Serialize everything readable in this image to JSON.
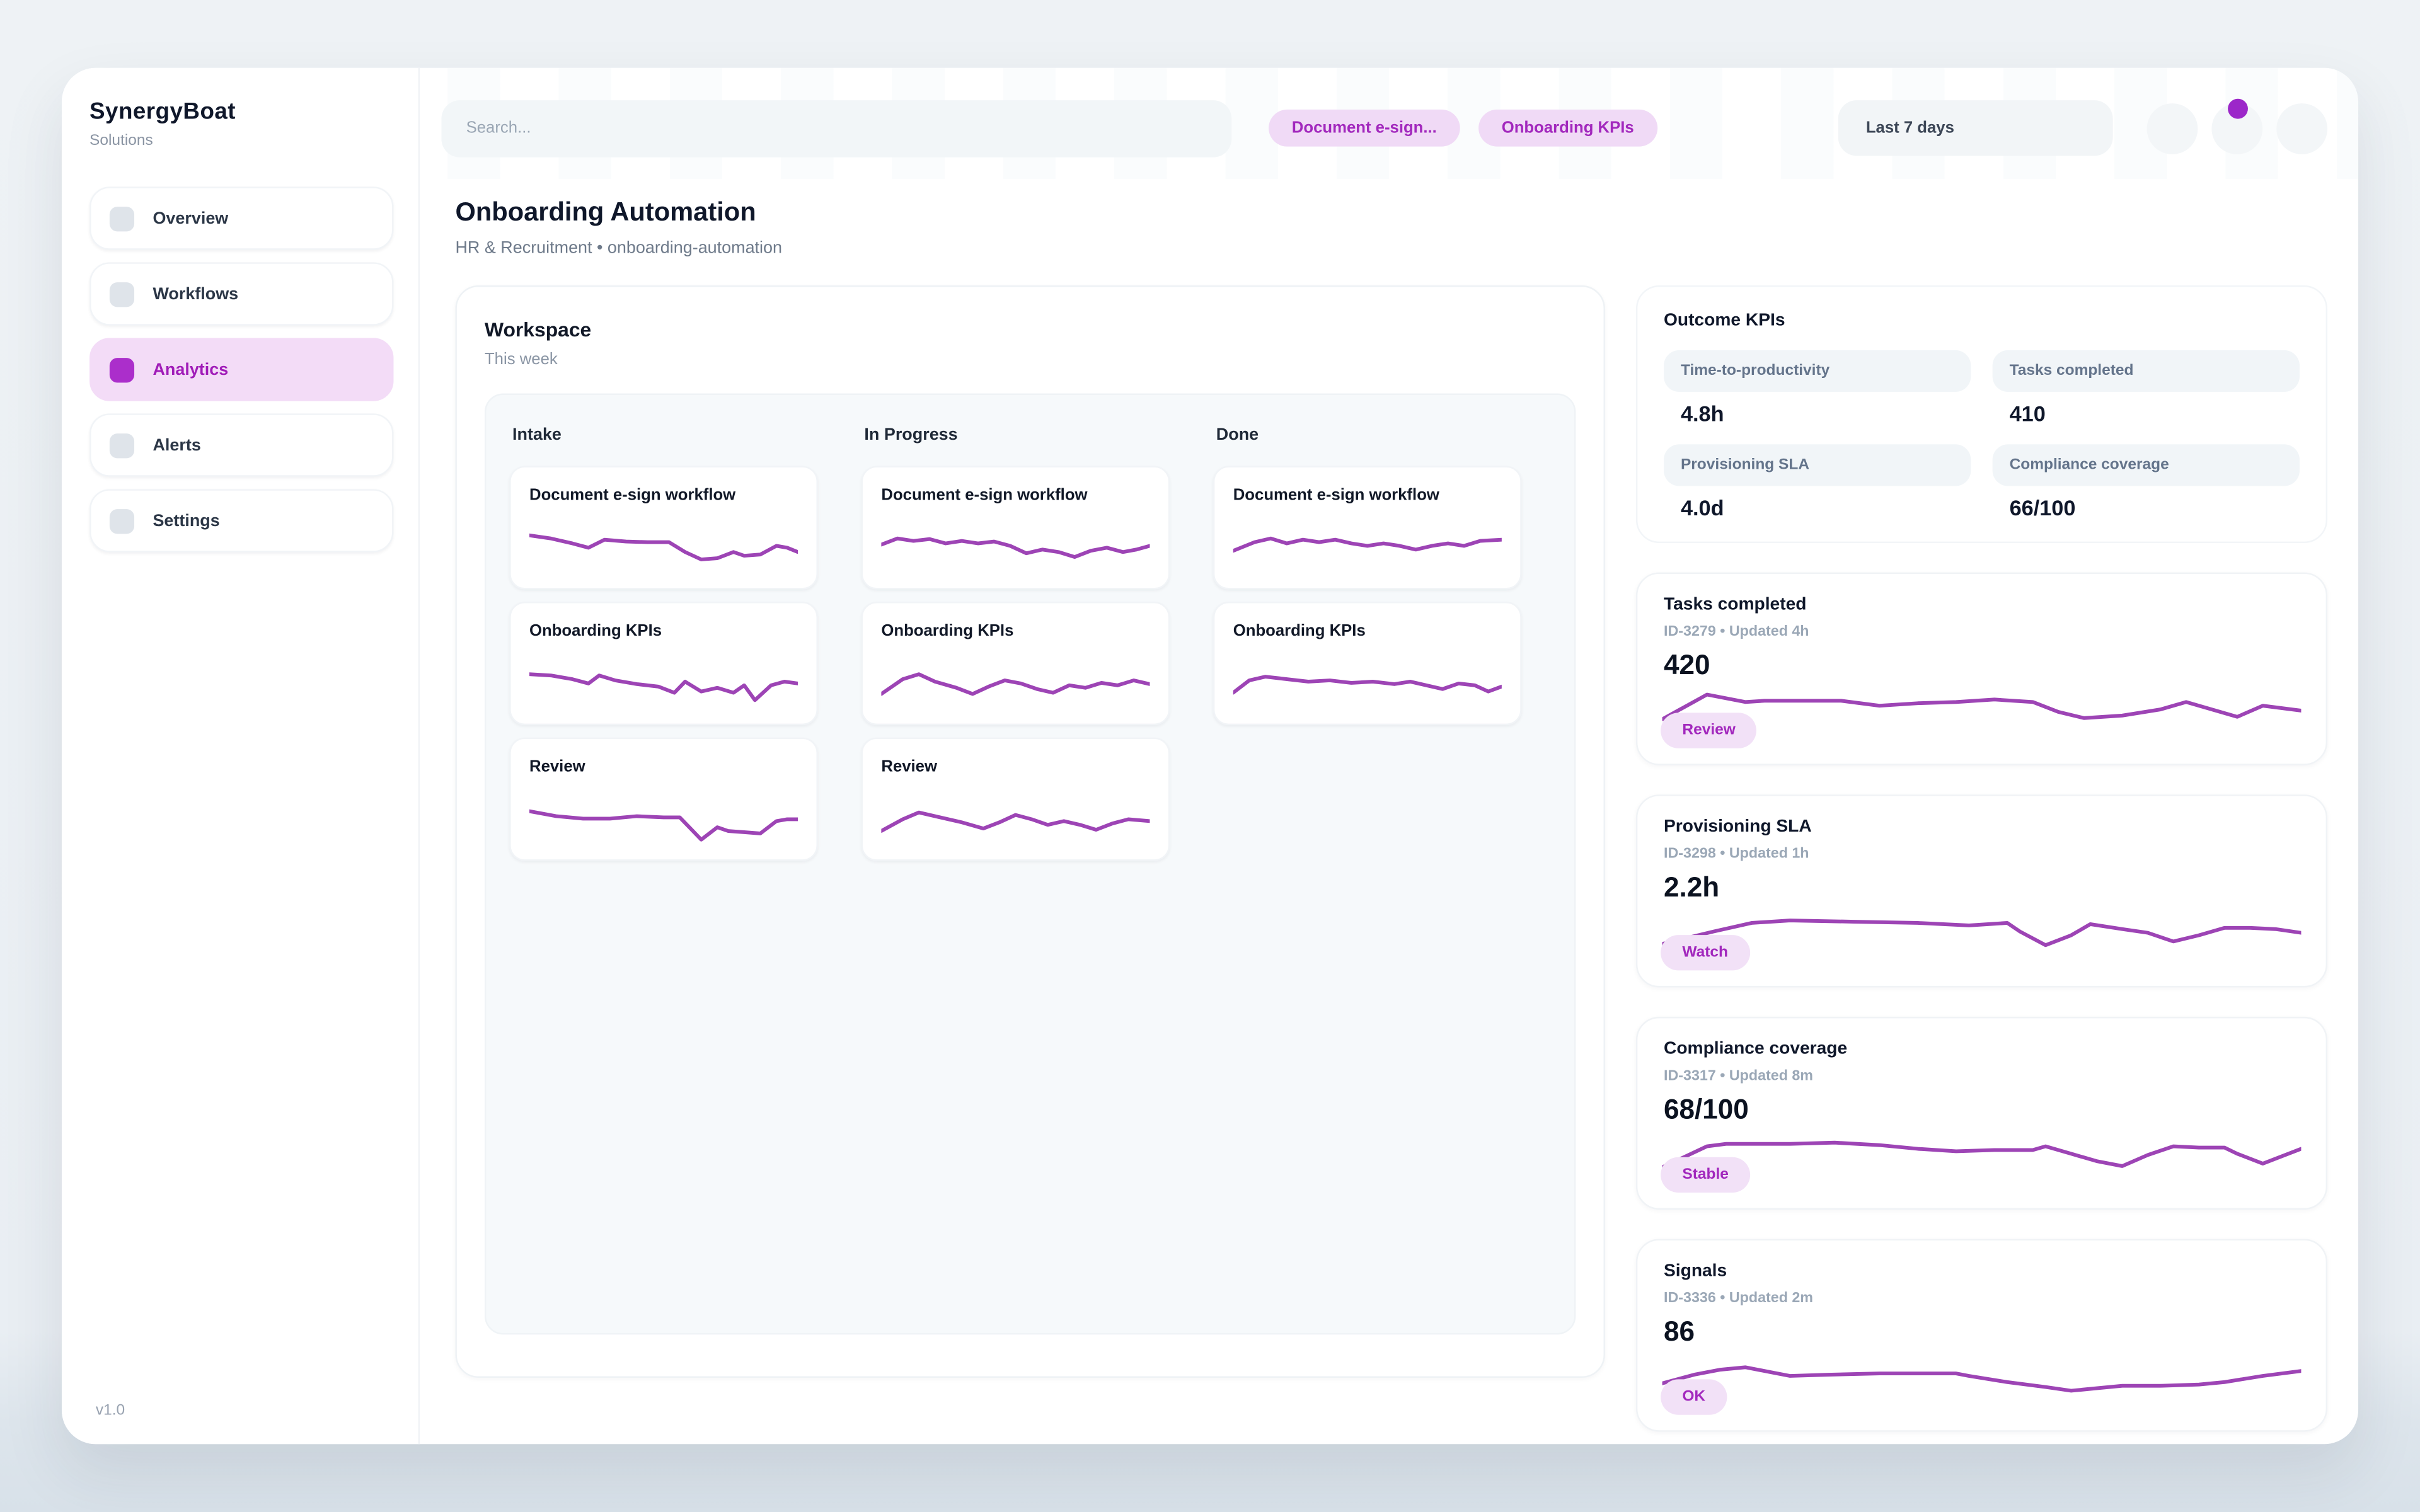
{
  "colors": {
    "accent": "#a92bc4",
    "spark": "#9d44b5",
    "chip_bg": "#f0daf6",
    "chip_text": "#a228bd",
    "active_nav_bg": "#f3dcf7"
  },
  "brand": {
    "name": "SynergyBoat",
    "tagline": "Solutions",
    "version": "v1.0"
  },
  "sidebar": {
    "items": [
      {
        "label": "Overview",
        "active": false
      },
      {
        "label": "Workflows",
        "active": false
      },
      {
        "label": "Analytics",
        "active": true
      },
      {
        "label": "Alerts",
        "active": false
      },
      {
        "label": "Settings",
        "active": false
      }
    ]
  },
  "topbar": {
    "search_placeholder": "Search...",
    "chips": [
      "Document e-sign...",
      "Onboarding KPIs"
    ],
    "range_button": "Last 7 days"
  },
  "page": {
    "title": "Onboarding Automation",
    "breadcrumb": "HR & Recruitment • onboarding-automation"
  },
  "workspace": {
    "title": "Workspace",
    "subtitle": "This week",
    "columns": [
      {
        "name": "Intake",
        "cards": [
          {
            "label": "Document e-sign workflow",
            "spark": "intake_doc_esign"
          },
          {
            "label": "Onboarding KPIs",
            "spark": "intake_onboarding_kpis"
          },
          {
            "label": "Review",
            "spark": "intake_review"
          }
        ]
      },
      {
        "name": "In Progress",
        "cards": [
          {
            "label": "Document e-sign workflow",
            "spark": "inprogress_doc_esign"
          },
          {
            "label": "Onboarding KPIs",
            "spark": "inprogress_onboarding_kpis"
          },
          {
            "label": "Review",
            "spark": "inprogress_review"
          }
        ]
      },
      {
        "name": "Done",
        "cards": [
          {
            "label": "Document e-sign workflow",
            "spark": "done_doc_esign"
          },
          {
            "label": "Onboarding KPIs",
            "spark": "done_onboarding_kpis"
          }
        ]
      }
    ]
  },
  "kpis": {
    "title": "Outcome KPIs",
    "stats": [
      {
        "label": "Time-to-productivity",
        "value": "4.8h"
      },
      {
        "label": "Tasks completed",
        "value": "410"
      },
      {
        "label": "Provisioning SLA",
        "value": "4.0d"
      },
      {
        "label": "Compliance coverage",
        "value": "66/100"
      }
    ]
  },
  "metric_cards": [
    {
      "title": "Tasks completed",
      "meta": "ID-3279 • Updated 4h",
      "value": "420",
      "badge": "Review",
      "spark": "rail_tasks_completed"
    },
    {
      "title": "Provisioning SLA",
      "meta": "ID-3298 • Updated 1h",
      "value": "2.2h",
      "badge": "Watch",
      "spark": "rail_provisioning_sla"
    },
    {
      "title": "Compliance coverage",
      "meta": "ID-3317 • Updated 8m",
      "value": "68/100",
      "badge": "Stable",
      "spark": "rail_compliance_coverage"
    },
    {
      "title": "Signals",
      "meta": "ID-3336 • Updated 2m",
      "value": "86",
      "badge": "OK",
      "spark": "rail_signals"
    }
  ],
  "chart_data": {
    "type": "line",
    "note": "Unlabeled purple sparklines; points are [x,y] in a 0-100 viewBox, y increases downward. Values estimated from pixels.",
    "series": {
      "intake_doc_esign": [
        [
          0,
          35
        ],
        [
          8,
          40
        ],
        [
          16,
          48
        ],
        [
          22,
          55
        ],
        [
          28,
          42
        ],
        [
          36,
          45
        ],
        [
          44,
          46
        ],
        [
          52,
          46
        ],
        [
          58,
          62
        ],
        [
          64,
          74
        ],
        [
          70,
          72
        ],
        [
          76,
          62
        ],
        [
          80,
          68
        ],
        [
          86,
          66
        ],
        [
          92,
          52
        ],
        [
          96,
          55
        ],
        [
          100,
          62
        ]
      ],
      "intake_onboarding_kpis": [
        [
          0,
          40
        ],
        [
          8,
          42
        ],
        [
          16,
          48
        ],
        [
          22,
          55
        ],
        [
          26,
          42
        ],
        [
          32,
          50
        ],
        [
          40,
          56
        ],
        [
          48,
          60
        ],
        [
          54,
          70
        ],
        [
          58,
          52
        ],
        [
          64,
          68
        ],
        [
          70,
          62
        ],
        [
          76,
          70
        ],
        [
          80,
          58
        ],
        [
          84,
          82
        ],
        [
          90,
          58
        ],
        [
          95,
          52
        ],
        [
          100,
          55
        ]
      ],
      "intake_review": [
        [
          0,
          42
        ],
        [
          10,
          50
        ],
        [
          20,
          54
        ],
        [
          30,
          54
        ],
        [
          40,
          50
        ],
        [
          50,
          52
        ],
        [
          56,
          52
        ],
        [
          60,
          70
        ],
        [
          64,
          88
        ],
        [
          70,
          68
        ],
        [
          74,
          74
        ],
        [
          80,
          76
        ],
        [
          86,
          78
        ],
        [
          92,
          58
        ],
        [
          96,
          55
        ],
        [
          100,
          55
        ]
      ],
      "inprogress_doc_esign": [
        [
          0,
          50
        ],
        [
          6,
          40
        ],
        [
          12,
          44
        ],
        [
          18,
          41
        ],
        [
          24,
          48
        ],
        [
          30,
          44
        ],
        [
          36,
          48
        ],
        [
          42,
          45
        ],
        [
          48,
          52
        ],
        [
          54,
          64
        ],
        [
          60,
          58
        ],
        [
          66,
          62
        ],
        [
          72,
          70
        ],
        [
          78,
          60
        ],
        [
          84,
          55
        ],
        [
          90,
          62
        ],
        [
          95,
          58
        ],
        [
          100,
          52
        ]
      ],
      "inprogress_onboarding_kpis": [
        [
          0,
          72
        ],
        [
          8,
          48
        ],
        [
          14,
          40
        ],
        [
          20,
          52
        ],
        [
          28,
          62
        ],
        [
          34,
          72
        ],
        [
          40,
          60
        ],
        [
          46,
          50
        ],
        [
          52,
          55
        ],
        [
          58,
          64
        ],
        [
          64,
          70
        ],
        [
          70,
          58
        ],
        [
          76,
          62
        ],
        [
          82,
          54
        ],
        [
          88,
          58
        ],
        [
          94,
          50
        ],
        [
          100,
          56
        ]
      ],
      "inprogress_review": [
        [
          0,
          74
        ],
        [
          8,
          55
        ],
        [
          14,
          44
        ],
        [
          22,
          52
        ],
        [
          30,
          60
        ],
        [
          38,
          70
        ],
        [
          44,
          60
        ],
        [
          50,
          48
        ],
        [
          56,
          55
        ],
        [
          62,
          64
        ],
        [
          68,
          58
        ],
        [
          74,
          64
        ],
        [
          80,
          72
        ],
        [
          86,
          62
        ],
        [
          92,
          55
        ],
        [
          100,
          58
        ]
      ],
      "done_doc_esign": [
        [
          0,
          60
        ],
        [
          8,
          46
        ],
        [
          14,
          40
        ],
        [
          20,
          48
        ],
        [
          26,
          42
        ],
        [
          32,
          46
        ],
        [
          38,
          42
        ],
        [
          44,
          48
        ],
        [
          50,
          52
        ],
        [
          56,
          48
        ],
        [
          62,
          52
        ],
        [
          68,
          58
        ],
        [
          74,
          52
        ],
        [
          80,
          48
        ],
        [
          86,
          52
        ],
        [
          92,
          44
        ],
        [
          100,
          42
        ]
      ],
      "done_onboarding_kpis": [
        [
          0,
          70
        ],
        [
          6,
          50
        ],
        [
          12,
          44
        ],
        [
          20,
          48
        ],
        [
          28,
          52
        ],
        [
          36,
          50
        ],
        [
          44,
          54
        ],
        [
          52,
          52
        ],
        [
          60,
          56
        ],
        [
          66,
          52
        ],
        [
          72,
          58
        ],
        [
          78,
          64
        ],
        [
          84,
          55
        ],
        [
          90,
          58
        ],
        [
          95,
          68
        ],
        [
          100,
          60
        ]
      ],
      "rail_tasks_completed": [
        [
          0,
          78
        ],
        [
          7,
          38
        ],
        [
          13,
          50
        ],
        [
          16,
          48
        ],
        [
          28,
          48
        ],
        [
          34,
          56
        ],
        [
          40,
          52
        ],
        [
          46,
          50
        ],
        [
          52,
          46
        ],
        [
          58,
          50
        ],
        [
          62,
          66
        ],
        [
          66,
          76
        ],
        [
          72,
          72
        ],
        [
          78,
          62
        ],
        [
          82,
          50
        ],
        [
          86,
          62
        ],
        [
          90,
          74
        ],
        [
          94,
          56
        ],
        [
          100,
          64
        ]
      ],
      "rail_provisioning_sla": [
        [
          0,
          82
        ],
        [
          8,
          62
        ],
        [
          14,
          48
        ],
        [
          20,
          44
        ],
        [
          30,
          46
        ],
        [
          40,
          48
        ],
        [
          48,
          52
        ],
        [
          54,
          48
        ],
        [
          56,
          62
        ],
        [
          60,
          84
        ],
        [
          64,
          68
        ],
        [
          67,
          50
        ],
        [
          72,
          58
        ],
        [
          76,
          64
        ],
        [
          80,
          78
        ],
        [
          84,
          68
        ],
        [
          88,
          56
        ],
        [
          92,
          56
        ],
        [
          96,
          58
        ],
        [
          100,
          64
        ]
      ],
      "rail_compliance_coverage": [
        [
          0,
          84
        ],
        [
          7,
          50
        ],
        [
          10,
          46
        ],
        [
          20,
          46
        ],
        [
          27,
          44
        ],
        [
          34,
          48
        ],
        [
          40,
          54
        ],
        [
          46,
          58
        ],
        [
          52,
          56
        ],
        [
          58,
          56
        ],
        [
          60,
          50
        ],
        [
          64,
          62
        ],
        [
          68,
          74
        ],
        [
          72,
          82
        ],
        [
          76,
          64
        ],
        [
          80,
          50
        ],
        [
          84,
          52
        ],
        [
          88,
          52
        ],
        [
          90,
          62
        ],
        [
          94,
          78
        ],
        [
          100,
          54
        ]
      ],
      "rail_signals": [
        [
          0,
          74
        ],
        [
          5,
          60
        ],
        [
          9,
          52
        ],
        [
          13,
          48
        ],
        [
          17,
          56
        ],
        [
          20,
          62
        ],
        [
          26,
          60
        ],
        [
          34,
          58
        ],
        [
          40,
          58
        ],
        [
          46,
          58
        ],
        [
          48,
          62
        ],
        [
          54,
          72
        ],
        [
          60,
          80
        ],
        [
          64,
          86
        ],
        [
          68,
          82
        ],
        [
          72,
          78
        ],
        [
          78,
          78
        ],
        [
          84,
          76
        ],
        [
          88,
          72
        ],
        [
          94,
          62
        ],
        [
          100,
          54
        ]
      ]
    }
  }
}
